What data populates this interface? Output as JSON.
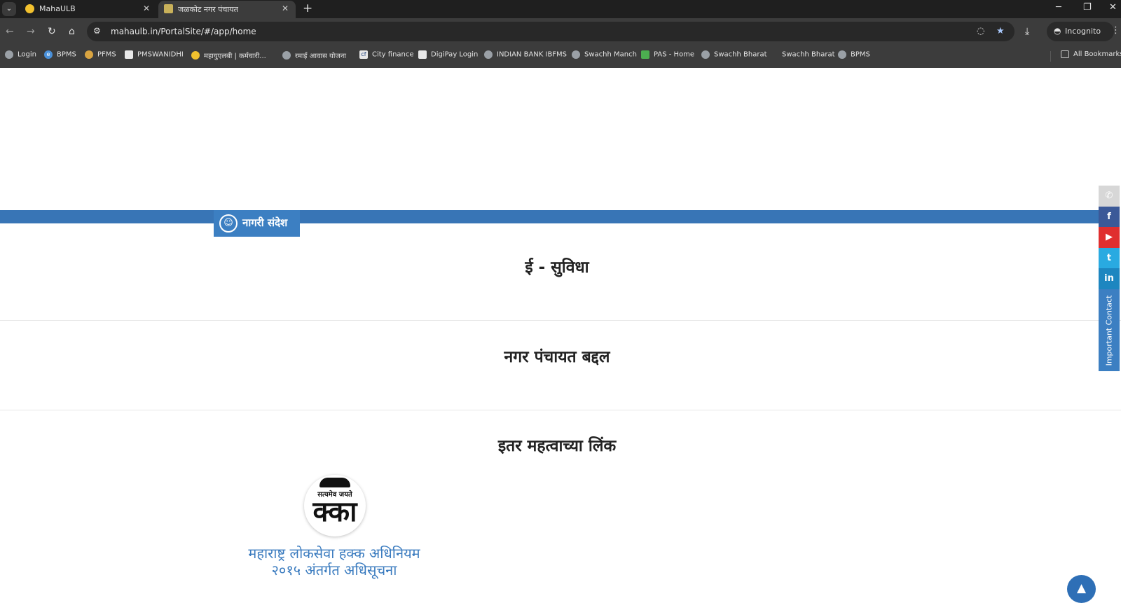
{
  "browser": {
    "tabs": [
      {
        "title": "MahaULB",
        "active": false
      },
      {
        "title": "जळकोट नगर पंचायत",
        "active": true
      }
    ],
    "url": "mahaulb.in/PortalSite/#/app/home",
    "profile_label": "Incognito",
    "bookmarks": [
      {
        "label": "Login",
        "icon": "globe-icon"
      },
      {
        "label": "BPMS",
        "icon": "e-icon"
      },
      {
        "label": "PFMS",
        "icon": "pfms-icon"
      },
      {
        "label": "PMSWANIDHI",
        "icon": "pmswanidhi-icon"
      },
      {
        "label": "महायुएलबी | कर्मचारी...",
        "icon": "mahaulb-icon"
      },
      {
        "label": "रमाई आवास योजना",
        "icon": "globe-icon"
      },
      {
        "label": "City finance",
        "icon": "cf-icon"
      },
      {
        "label": "DigiPay Login",
        "icon": "digipay-icon"
      },
      {
        "label": "INDIAN BANK IBFMS",
        "icon": "globe-icon"
      },
      {
        "label": "Swachh Manch",
        "icon": "globe-icon"
      },
      {
        "label": "PAS - Home",
        "icon": "pas-icon"
      },
      {
        "label": "Swachh Bharat",
        "icon": "globe-icon"
      },
      {
        "label": "Swachh Bharat",
        "icon": "blank-icon"
      },
      {
        "label": "BPMS",
        "icon": "globe-icon"
      }
    ],
    "all_bookmarks_label": "All Bookmarks"
  },
  "page": {
    "news_label": "नागरी संदेश",
    "sections": [
      {
        "title": "ई - सुविधा"
      },
      {
        "title": "नगर पंचायत बद्दल"
      },
      {
        "title": "इतर महत्वाच्या लिंक"
      }
    ],
    "logo": {
      "motto": "सत्यमेव जयते",
      "mark": "क्का",
      "caption_line1": "महाराष्ट्र लोकसेवा हक्क अधिनियम",
      "caption_line2": "२०१५ अंतर्गत अधिसूचना"
    },
    "contact_tab_label": "Important Contact"
  },
  "social": [
    {
      "icon": "phone-icon",
      "color": "#d7d7d7",
      "glyph": "✆"
    },
    {
      "icon": "facebook-icon",
      "color": "#3b5998",
      "glyph": "f"
    },
    {
      "icon": "youtube-icon",
      "color": "#e02f2f",
      "glyph": "▶"
    },
    {
      "icon": "twitter-icon",
      "color": "#29aae1",
      "glyph": "t"
    },
    {
      "icon": "linkedin-icon",
      "color": "#1d86c0",
      "glyph": "in"
    }
  ],
  "colors": {
    "accent_blue": "#3875b6",
    "caption_blue": "#3a7bbf"
  }
}
